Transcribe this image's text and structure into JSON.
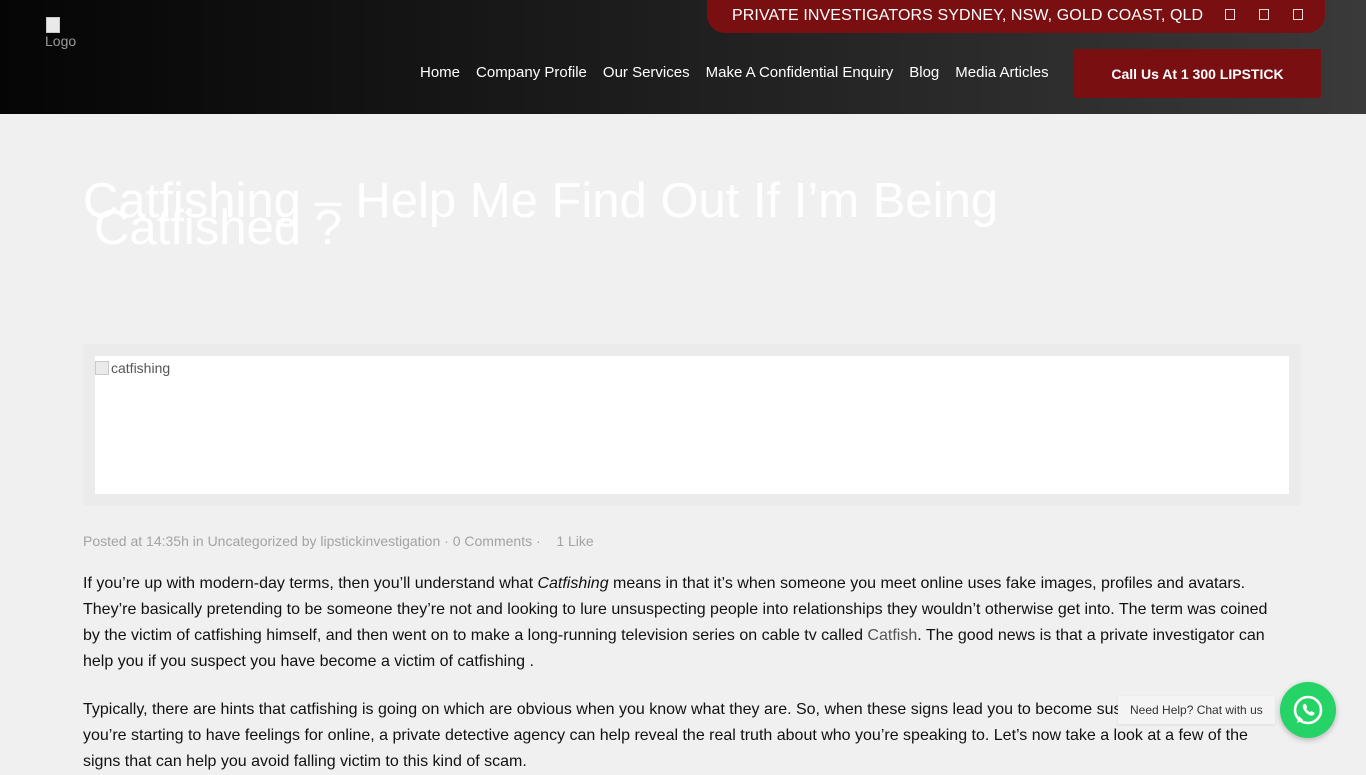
{
  "header": {
    "logo_alt": "Logo",
    "topbar_text": "PRIVATE INVESTIGATORS SYDNEY, NSW, GOLD COAST, QLD",
    "social_icons": [
      "social-icon-1",
      "social-icon-2",
      "social-icon-3"
    ],
    "nav": [
      {
        "label": "Home"
      },
      {
        "label": "Company Profile"
      },
      {
        "label": "Our Services"
      },
      {
        "label": "Make A Confidential Enquiry"
      },
      {
        "label": "Blog"
      },
      {
        "label": "Media Articles"
      }
    ],
    "cta_label": "Call Us At 1 300 LIPSTICK",
    "brand_color": "#7a0f12"
  },
  "post": {
    "title_line1": "Catfishing – Help Me Find Out If I’m Being",
    "title_line2": "Catfished ?",
    "image_alt": "catfishing",
    "meta": {
      "posted_prefix": "Posted at 14:35h",
      "in_word": "in",
      "category": "Uncategorized",
      "by_word": "by",
      "author": "lipstickinvestigation",
      "separator": "·",
      "comments": "0 Comments",
      "likes": "1 Like"
    },
    "p1": {
      "a": "If you’re up with modern-day terms, then you’ll understand what ",
      "b": "Catfishing",
      "c": " means in that it’s when someone you meet online uses fake images, profiles and avatars. They’re basically pretending to be someone they’re not and looking to lure unsuspecting people into relationships they wouldn’t otherwise get into. The term was coined by the victim of catfishing himself, and then went on to make a long-running television series on cable tv called ",
      "link": "Catfish",
      "d": ". The good news is that a private investigator  can help you if you suspect you have become a victim of catfishing ."
    },
    "p2": "Typically, there are hints that catfishing is going on which are obvious when you know what they are. So,  when these signs lead you to become suspicious of someone you’re starting to have feelings for online, a private detective agency  can help reveal the real truth about who you’re speaking to. Let’s now take a look at a few of the signs that can help you avoid falling victim to this kind of scam."
  },
  "chat": {
    "label": "Need Help? Chat with us",
    "icon": "whatsapp-icon",
    "color": "#25d366"
  }
}
